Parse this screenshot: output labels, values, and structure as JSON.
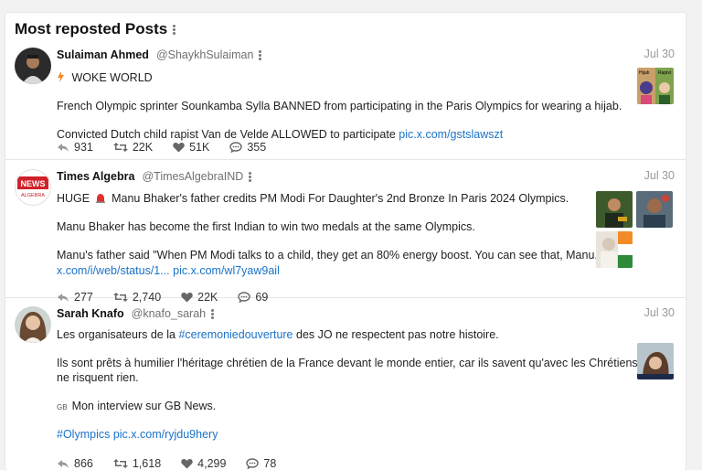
{
  "panel": {
    "title": "Most reposted Posts"
  },
  "posts": [
    {
      "name": "Sulaiman Ahmed",
      "handle": "@ShaykhSulaiman",
      "date": "Jul 30",
      "lines": [
        "WOKE WORLD",
        "French Olympic sprinter Sounkamba Sylla BANNED from participating in the Paris Olympics for wearing a hijab.",
        "Convicted Dutch child rapist Van de Velde ALLOWED to participate"
      ],
      "link": "pic.x.com/gstslawszt",
      "thumb_labels": [
        "Hijab",
        "Rapist"
      ],
      "stats": {
        "replies": "931",
        "reposts": "22K",
        "likes": "51K",
        "comments": "355"
      }
    },
    {
      "name": "Times Algebra",
      "handle": "@TimesAlgebraIND",
      "date": "Jul 30",
      "avatar_text": [
        "NEWS",
        "ALGEBRA"
      ],
      "lines": [
        "HUGE",
        "Manu Bhaker's father credits PM Modi For Daughter's 2nd Bronze In Paris 2024 Olympics.",
        "Manu Bhaker has become the first Indian to win two medals at the same Olympics.",
        "Manu's father said \"When PM Modi talks to a child, they get an 80% energy boost. You can see that, Manu..."
      ],
      "links": [
        "x.com/i/web/status/1...",
        "pic.x.com/wl7yaw9ail"
      ],
      "stats": {
        "replies": "277",
        "reposts": "2,740",
        "likes": "22K",
        "comments": "69"
      }
    },
    {
      "name": "Sarah Knafo",
      "handle": "@knafo_sarah",
      "date": "Jul 30",
      "lines": {
        "l1_pre": "Les organisateurs de la",
        "l1_tag": "#ceremoniedouverture",
        "l1_post": "des JO ne respectent pas notre histoire.",
        "l2": "Ils sont prêts à humilier l'héritage chrétien de la France devant le monde entier, car ils savent qu'avec les Chrétiens, ils",
        "l3": "ne risquent rien.",
        "l4_flag": "GB",
        "l4": "Mon interview sur GB News."
      },
      "links": [
        "#Olympics",
        "pic.x.com/ryjdu9hery"
      ],
      "stats": {
        "replies": "866",
        "reposts": "1,618",
        "likes": "4,299",
        "comments": "78"
      }
    }
  ],
  "colors": {
    "link": "#1a73c9",
    "muted": "#707070",
    "fire": "#f08a24",
    "siren": "#e0312b"
  },
  "icons": [
    "reply-icon",
    "repost-icon",
    "heart-icon",
    "comment-icon",
    "kebab-icon",
    "fire-icon",
    "siren-icon"
  ]
}
